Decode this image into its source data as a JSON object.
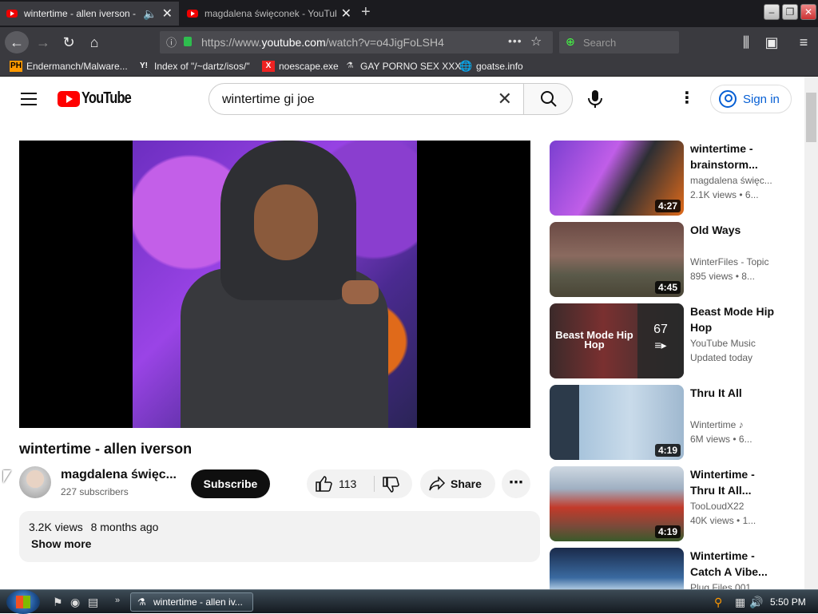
{
  "browser": {
    "tabs": [
      {
        "title": "wintertime - allen iverson - YouTube",
        "active": true,
        "audio_icon": "speaker-icon"
      },
      {
        "title": "magdalena święconek - YouTube",
        "active": false
      }
    ],
    "url_prefix": "https://www.",
    "url_domain": "youtube.com",
    "url_path": "/watch?v=o4JigFoLSH4",
    "search_placeholder": "Search",
    "bookmarks": [
      {
        "label": "Endermanch/Malware...",
        "icon": "PH"
      },
      {
        "label": "Index of \"/~dartz/isos/\"",
        "icon": "Y!"
      },
      {
        "label": "noescape.exe",
        "icon": "X"
      },
      {
        "label": "GAY PORNO SEX XXX",
        "icon": "bag-icon"
      },
      {
        "label": "goatse.info",
        "icon": "globe-icon"
      }
    ]
  },
  "youtube": {
    "logo_text": "YouTube",
    "search_query": "wintertime gi joe",
    "signin_label": "Sign in",
    "video": {
      "title": "wintertime - allen iverson",
      "channel": "magdalena święc...",
      "subscribers": "227 subscribers",
      "subscribe_label": "Subscribe",
      "likes": "113",
      "share_label": "Share",
      "views": "3.2K views",
      "age": "8 months ago",
      "show_more": "Show more"
    },
    "recommendations": [
      {
        "title": "wintertime - brainstorm...",
        "channel": "magdalena święc...",
        "views": "2.1K views",
        "age": "• 6...",
        "duration": "4:27"
      },
      {
        "title": "Old Ways",
        "channel": "WinterFiles - Topic",
        "views": "895 views",
        "age": "• 8...",
        "duration": "4:45"
      },
      {
        "title": "Beast Mode Hip Hop",
        "channel": "YouTube Music",
        "views": "Updated today",
        "age": "",
        "duration": "",
        "playlist_count": "67",
        "thumb_text": "Beast Mode Hip Hop"
      },
      {
        "title": "Thru It All",
        "channel": "Wintertime ♪",
        "views": "6M views",
        "age": "• 6...",
        "duration": "4:19"
      },
      {
        "title": "Wintertime - Thru It All...",
        "channel": "TooLoudX22",
        "views": "40K views",
        "age": "• 1...",
        "duration": "4:19"
      },
      {
        "title": "Wintertime - Catch A Vibe...",
        "channel": "Plug Files 001",
        "views": "",
        "age": "",
        "duration": ""
      }
    ]
  },
  "taskbar": {
    "window_label": "wintertime - allen iv...",
    "clock": "5:50 PM"
  },
  "colors": {
    "yt_red": "#ff0000",
    "link_blue": "#065fd4",
    "chrome_dark": "#3a3a3f"
  }
}
